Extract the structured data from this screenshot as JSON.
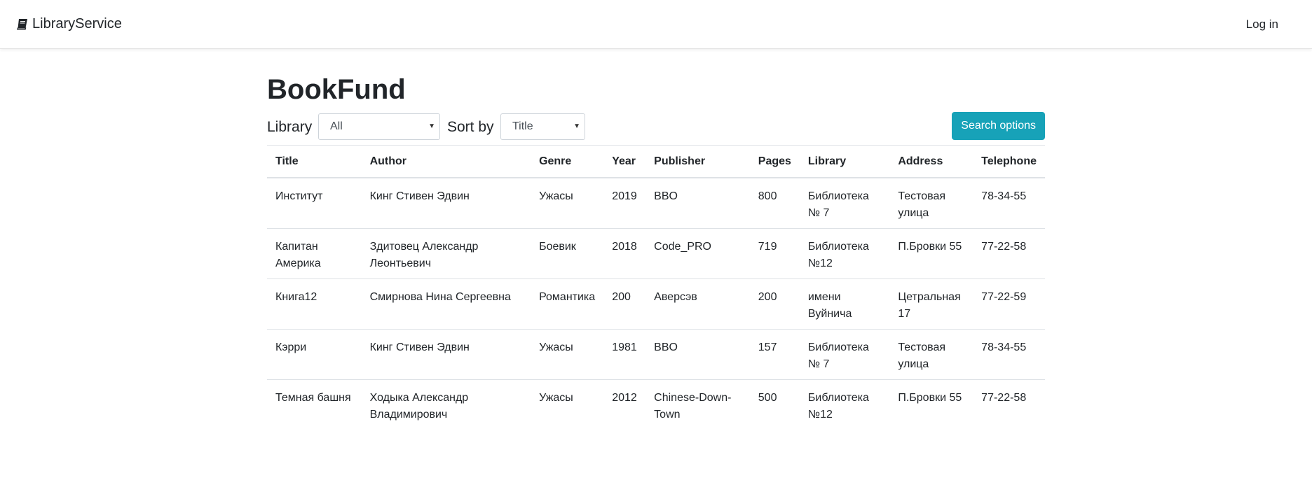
{
  "navbar": {
    "brand": "LibraryService",
    "brand_icon": "book-icon",
    "login": "Log in"
  },
  "page": {
    "title": "BookFund"
  },
  "filters": {
    "library_label": "Library",
    "library_value": "All",
    "sort_label": "Sort by",
    "sort_value": "Title",
    "search_button": "Search options"
  },
  "colors": {
    "accent": "#17a2b8",
    "text": "#212529",
    "border": "#dee2e6"
  },
  "table": {
    "headers": [
      "Title",
      "Author",
      "Genre",
      "Year",
      "Publisher",
      "Pages",
      "Library",
      "Address",
      "Telephone"
    ],
    "rows": [
      [
        "Институт",
        "Кинг Стивен Эдвин",
        "Ужасы",
        "2019",
        "BBO",
        "800",
        "Библиотека № 7",
        "Тестовая улица",
        "78-34-55"
      ],
      [
        "Капитан Америка",
        "Здитовец Александр Леонтьевич",
        "Боевик",
        "2018",
        "Code_PRO",
        "719",
        "Библиотека №12",
        "П.Бровки 55",
        "77-22-58"
      ],
      [
        "Книга12",
        "Смирнова Нина Сергеевна",
        "Романтика",
        "200",
        "Аверсэв",
        "200",
        "имени Вуйнича",
        "Цетральная 17",
        "77-22-59"
      ],
      [
        "Кэрри",
        "Кинг Стивен Эдвин",
        "Ужасы",
        "1981",
        "BBO",
        "157",
        "Библиотека № 7",
        "Тестовая улица",
        "78-34-55"
      ],
      [
        "Темная башня",
        "Ходыка Александр Владимирович",
        "Ужасы",
        "2012",
        "Chinese-Down-Town",
        "500",
        "Библиотека №12",
        "П.Бровки 55",
        "77-22-58"
      ]
    ]
  }
}
